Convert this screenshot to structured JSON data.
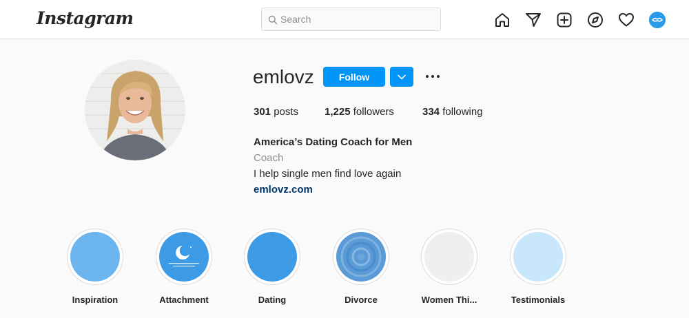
{
  "topbar": {
    "logo": "Instagram",
    "search_placeholder": "Search",
    "nav_icons": [
      "home-icon",
      "direct-message-icon",
      "new-post-icon",
      "explore-icon",
      "activity-heart-icon",
      "profile-avatar"
    ]
  },
  "profile": {
    "username": "emlovz",
    "follow_label": "Follow",
    "stats": {
      "posts_count": "301",
      "posts_label": "posts",
      "followers_count": "1,225",
      "followers_label": "followers",
      "following_count": "334",
      "following_label": "following"
    },
    "bio": {
      "name": "America’s Dating Coach for Men",
      "category": "Coach",
      "description": "I help single men find love again",
      "link": "emlovz.com"
    }
  },
  "highlights": [
    {
      "label": "Inspiration",
      "color": "#6cb5ef"
    },
    {
      "label": "Attachment",
      "color": "#3d9be6"
    },
    {
      "label": "Dating",
      "color": "#3d9be6"
    },
    {
      "label": "Divorce",
      "color": "#5a9ad6"
    },
    {
      "label": "Women Thi...",
      "color": "#efefef"
    },
    {
      "label": "Testimonials",
      "color": "#c9e7fb"
    }
  ],
  "colors": {
    "accent": "#0095f6",
    "link": "#00376b",
    "secondary_text": "#8e8e8e"
  }
}
